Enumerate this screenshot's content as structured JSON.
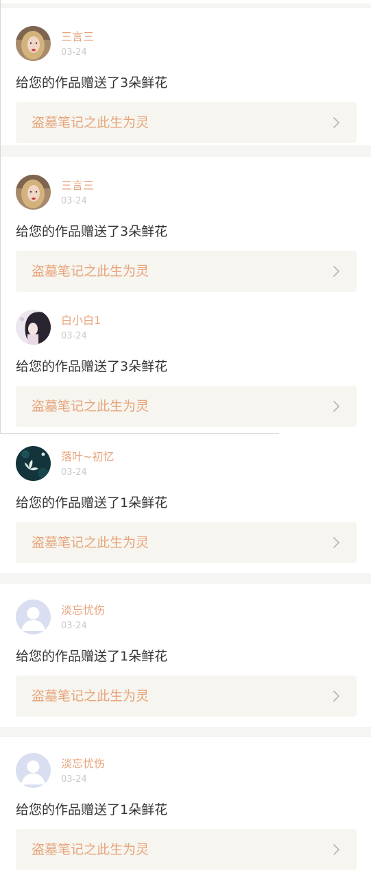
{
  "feed": {
    "items": [
      {
        "username": "三言三",
        "date": "03-24",
        "message": "给您的作品赠送了3朵鲜花",
        "work_title": "盗墓笔记之此生为灵",
        "avatar_icon": "avatar-blonde-girl-icon"
      },
      {
        "username": "三言三",
        "date": "03-24",
        "message": "给您的作品赠送了3朵鲜花",
        "work_title": "盗墓笔记之此生为灵",
        "avatar_icon": "avatar-blonde-girl-icon"
      },
      {
        "username": "白小白1",
        "date": "03-24",
        "message": "给您的作品赠送了3朵鲜花",
        "work_title": "盗墓笔记之此生为灵",
        "avatar_icon": "avatar-anime-girl-icon"
      },
      {
        "username": "落叶~初忆",
        "date": "03-24",
        "message": "给您的作品赠送了1朵鲜花",
        "work_title": "盗墓笔记之此生为灵",
        "avatar_icon": "avatar-lotus-icon"
      },
      {
        "username": "淡忘忧伤",
        "date": "03-24",
        "message": "给您的作品赠送了1朵鲜花",
        "work_title": "盗墓笔记之此生为灵",
        "avatar_icon": "avatar-default-user-icon"
      },
      {
        "username": "淡忘忧伤",
        "date": "03-24",
        "message": "给您的作品赠送了1朵鲜花",
        "work_title": "盗墓笔记之此生为灵",
        "avatar_icon": "avatar-default-user-icon"
      }
    ]
  },
  "colors": {
    "accent": "#e7a47b",
    "page_bg": "#f5f5f4",
    "card_bg": "#ffffff",
    "link_bg": "#f6f5ef",
    "text": "#333333",
    "muted": "#c9c9c9"
  }
}
